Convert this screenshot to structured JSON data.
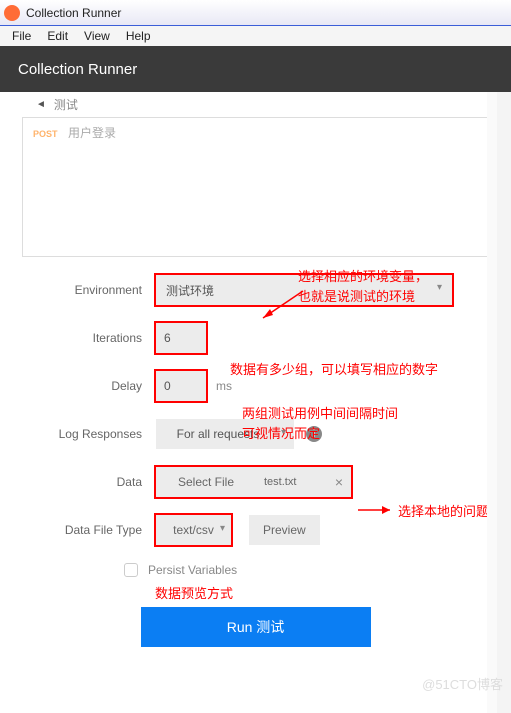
{
  "window": {
    "title": "Collection Runner"
  },
  "menu": {
    "file": "File",
    "edit": "Edit",
    "view": "View",
    "help": "Help"
  },
  "header": {
    "title": "Collection Runner"
  },
  "breadcrumb": {
    "name": "测试"
  },
  "request": {
    "method": "POST",
    "name": "用户登录"
  },
  "form": {
    "environment": {
      "label": "Environment",
      "value": "测试环境"
    },
    "iterations": {
      "label": "Iterations",
      "value": "6"
    },
    "delay": {
      "label": "Delay",
      "value": "0",
      "unit": "ms"
    },
    "log": {
      "label": "Log Responses",
      "value": "For all requests"
    },
    "data": {
      "label": "Data",
      "button": "Select File",
      "filename": "test.txt"
    },
    "filetype": {
      "label": "Data File Type",
      "value": "text/csv",
      "preview": "Preview"
    },
    "persist": {
      "label": "Persist Variables"
    }
  },
  "run": {
    "label": "Run 测试"
  },
  "annotations": {
    "env1": "选择相应的环境变量，",
    "env2": "也就是说测试的环境",
    "iter": "数据有多少组，可以填写相应的数字",
    "delay1": "两组测试用例中间间隔时间",
    "delay2": "可视情况而定",
    "data": "选择本地的问题",
    "type": "数据预览方式"
  },
  "watermark": "@51CTO博客"
}
